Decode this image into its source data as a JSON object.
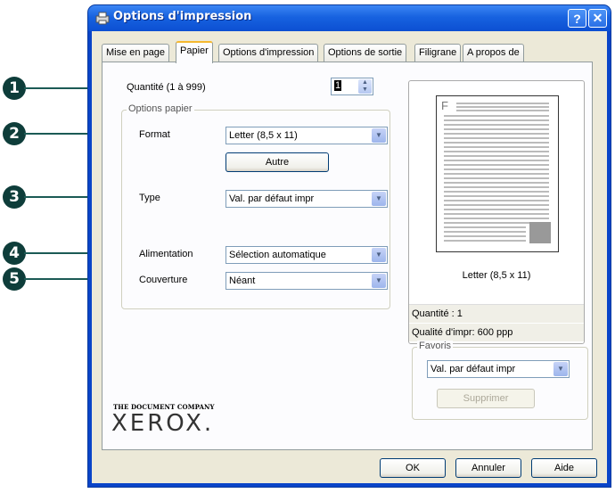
{
  "window": {
    "title": "Options d'impression",
    "help_label": "?",
    "close_label": "✕"
  },
  "tabs": [
    {
      "label": "Mise en page"
    },
    {
      "label": "Papier",
      "active": true
    },
    {
      "label": "Options d'impression"
    },
    {
      "label": "Options de sortie"
    },
    {
      "label": "Filigrane"
    },
    {
      "label": "A propos de"
    }
  ],
  "callouts": [
    "1",
    "2",
    "3",
    "4",
    "5"
  ],
  "paper": {
    "quantity_label": "Quantité (1 à 999)",
    "quantity_value": "1",
    "group_title": "Options papier",
    "format_label": "Format",
    "format_value": "Letter (8,5 x 11)",
    "other_button": "Autre",
    "type_label": "Type",
    "type_value": "Val. par défaut impr",
    "source_label": "Alimentation",
    "source_value": "Sélection automatique",
    "cover_label": "Couverture",
    "cover_value": "Néant"
  },
  "preview": {
    "page_letter": "F",
    "caption": "Letter (8,5 x 11)",
    "quantity_info": "Quantité : 1",
    "quality_info": "Qualité d'impr: 600 ppp"
  },
  "favorites": {
    "title": "Favoris",
    "value": "Val. par défaut impr",
    "delete_button": "Supprimer"
  },
  "brand": {
    "tagline": "THE DOCUMENT COMPANY",
    "logo": "XEROX."
  },
  "footer": {
    "ok": "OK",
    "cancel": "Annuler",
    "help": "Aide"
  },
  "colors": {
    "titlebar": "#0c4fd2",
    "callout": "#0e3d3a",
    "active_tab_highlight": "#f5b830"
  }
}
